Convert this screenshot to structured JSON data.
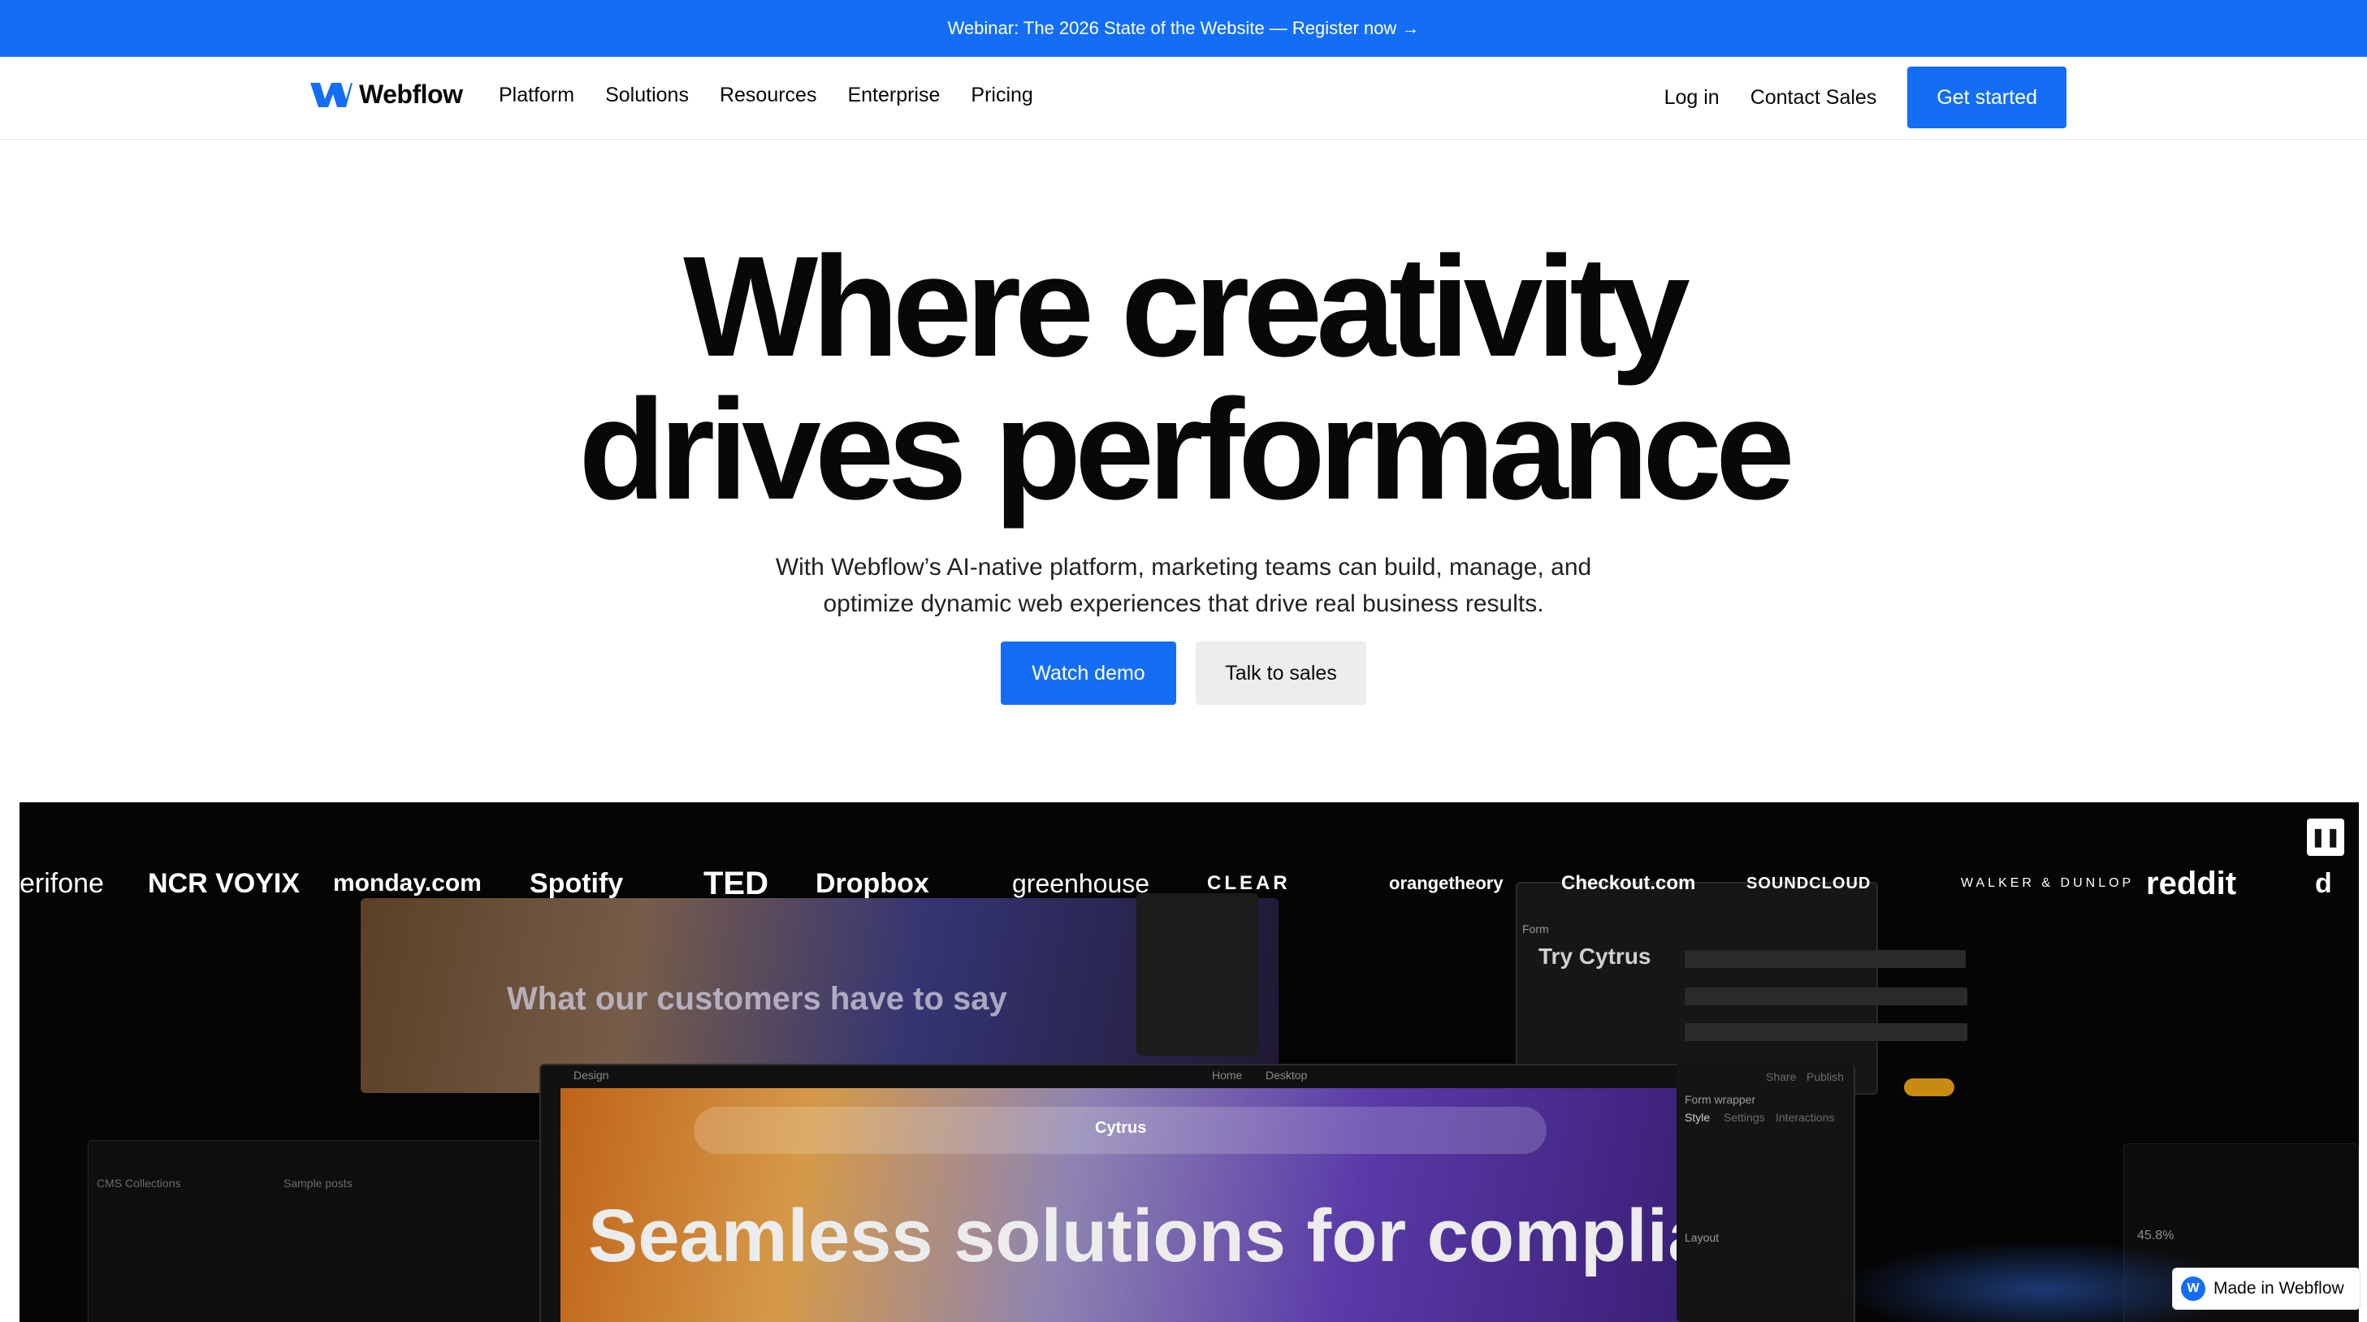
{
  "banner": {
    "text": "Webinar: The 2026 State of the Website — Register now →"
  },
  "nav": {
    "logo_text": "Webflow",
    "links": [
      "Platform",
      "Solutions",
      "Resources",
      "Enterprise",
      "Pricing"
    ],
    "login": "Log in",
    "contact": "Contact Sales",
    "cta": "Get started"
  },
  "hero": {
    "title_line1": "Where creativity",
    "title_line2": "drives performance",
    "subtitle": "With Webflow’s AI-native platform, marketing teams can build, manage, and optimize dynamic web experiences that drive real business results.",
    "primary_button": "Watch demo",
    "secondary_button": "Talk to sales"
  },
  "logos": [
    "erifone",
    "NCR VOYIX",
    "monday.com",
    "Spotify",
    "TED",
    "Dropbox",
    "greenhouse",
    "CLEAR",
    "orangetheory",
    "Checkout.com",
    "SOUNDCLOUD",
    "WALKER & DUNLOP",
    "reddit",
    "d"
  ],
  "showcase": {
    "back_heading": "What our customers have to say",
    "form_title": "Try Cytrus",
    "form_tab": "Form",
    "canvas_brand": "Cytrus",
    "canvas_heading": "Seamless solutions for compliance",
    "toolbar_design": "Design",
    "toolbar_home": "Home",
    "toolbar_desktop": "Desktop",
    "panel_style": "Style",
    "panel_settings": "Settings",
    "panel_interactions": "Interactions",
    "panel_share": "Share",
    "panel_publish": "Publish",
    "form_wrapper": "Form wrapper",
    "layout": "Layout",
    "cms_collections": "CMS Collections",
    "sample_posts": "Sample posts",
    "stat_value": "45.8%"
  },
  "badge": {
    "text": "Made in Webflow"
  },
  "colors": {
    "brand_blue": "#146ef5",
    "text_dark": "#080808",
    "secondary_bg": "#ededed"
  }
}
